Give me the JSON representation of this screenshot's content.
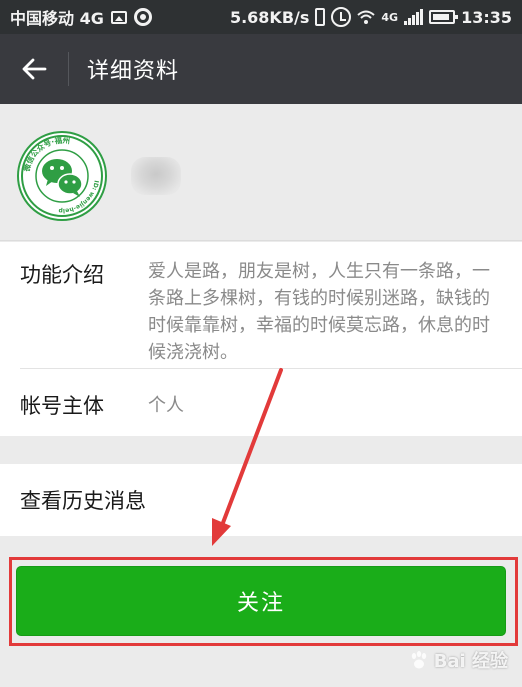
{
  "status_bar": {
    "carrier": "中国移动 4G",
    "speed": "5.68KB/s",
    "network_label": "4G",
    "time": "13:35"
  },
  "title_bar": {
    "back_icon": "back-arrow-icon",
    "title": "详细资料"
  },
  "profile": {
    "avatar_icon": "wechat-official-account-logo",
    "avatar_ring_text": "微信公众号·福州",
    "avatar_id_text": "ID: wenjie-help"
  },
  "info": {
    "intro_label": "功能介绍",
    "intro_text": "爱人是路，朋友是树，人生只有一条路，一条路上多棵树，有钱的时候别迷路，缺钱的时候靠靠树，幸福的时候莫忘路，休息的时候浇浇树。",
    "owner_label": "帐号主体",
    "owner_value": "个人"
  },
  "history": {
    "label": "查看历史消息"
  },
  "follow_button": {
    "label": "关注"
  },
  "annotations": {
    "highlight_color": "#e23a3a",
    "arrow_color": "#e23a3a"
  },
  "colors": {
    "accent_green": "#1aad19",
    "title_bar": "#393a3f",
    "status_bar": "#2e3133",
    "page_bg": "#ebebeb"
  },
  "watermark": {
    "text": "Bai 经验",
    "icon": "baidu-paw-icon"
  }
}
